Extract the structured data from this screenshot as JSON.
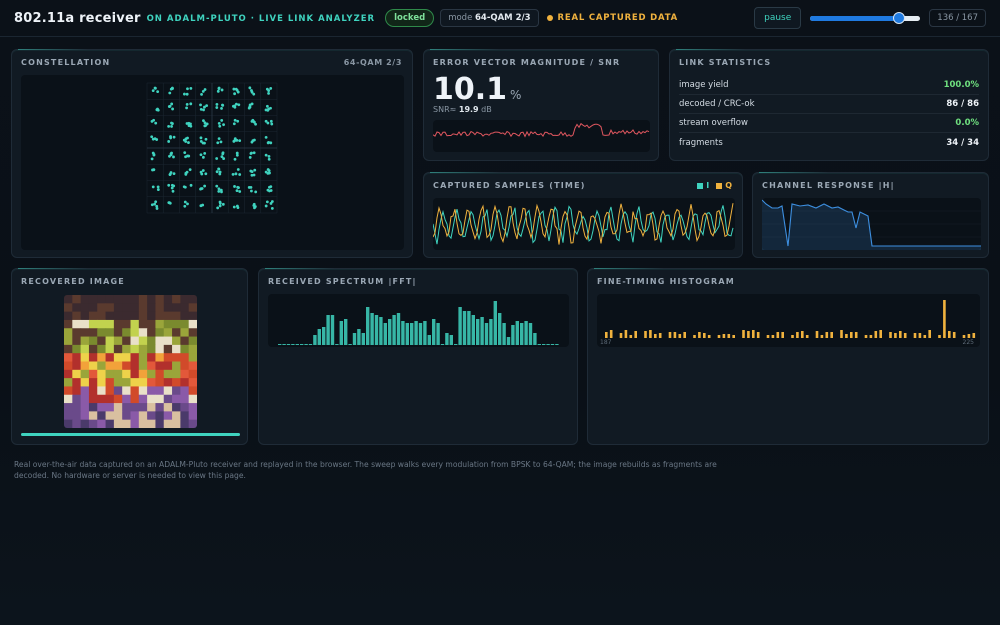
{
  "header": {
    "title": "802.11a receiver",
    "subtitle": "ON ADALM-PLUTO · LIVE LINK ANALYZER",
    "status_badge": "locked",
    "mode_prefix": "mode",
    "mode_value": "64-QAM 2/3",
    "data_source": "REAL CAPTURED DATA",
    "pause_label": "pause",
    "progress": 0.81,
    "counter": "136 / 167"
  },
  "constellation": {
    "title": "CONSTELLATION",
    "mode": "64-QAM 2/3",
    "point_color": "#3fd3bf"
  },
  "evm": {
    "title": "ERROR VECTOR MAGNITUDE / SNR",
    "value": "10.1",
    "unit": "%",
    "snr_label": "SNR≈",
    "snr_value": "19.9",
    "snr_unit": "dB",
    "trace_color": "#e0575f"
  },
  "link_stats": {
    "title": "LINK STATISTICS",
    "rows": [
      {
        "label": "image yield",
        "value": "100.0%",
        "color": "green"
      },
      {
        "label": "decoded / CRC-ok",
        "value": "86 / 86",
        "color": "white"
      },
      {
        "label": "stream overflow",
        "value": "0.0%",
        "color": "green"
      },
      {
        "label": "fragments",
        "value": "34 / 34",
        "color": "white"
      }
    ]
  },
  "samples": {
    "title": "CAPTURED SAMPLES (TIME)",
    "legend_i": "I",
    "legend_q": "Q",
    "color_i": "#3fd3bf",
    "color_q": "#f0b23e"
  },
  "channel": {
    "title": "CHANNEL RESPONSE |H|",
    "color": "#3d8fe0"
  },
  "recovered": {
    "title": "RECOVERED IMAGE",
    "progress": 1.0
  },
  "spectrum": {
    "title": "RECEIVED SPECTRUM |FFT|",
    "color": "#3fd3bf"
  },
  "timing": {
    "title": "FINE-TIMING HISTOGRAM",
    "x_start": "187",
    "x_end": "225",
    "color": "#f0b23e"
  },
  "footer": {
    "note": "Real over-the-air data captured on an ADALM-Pluto receiver and replayed in the browser. The sweep walks every modulation from BPSK to 64-QAM; the image rebuilds as fragments are decoded. No hardware or server is needed to view this page."
  }
}
